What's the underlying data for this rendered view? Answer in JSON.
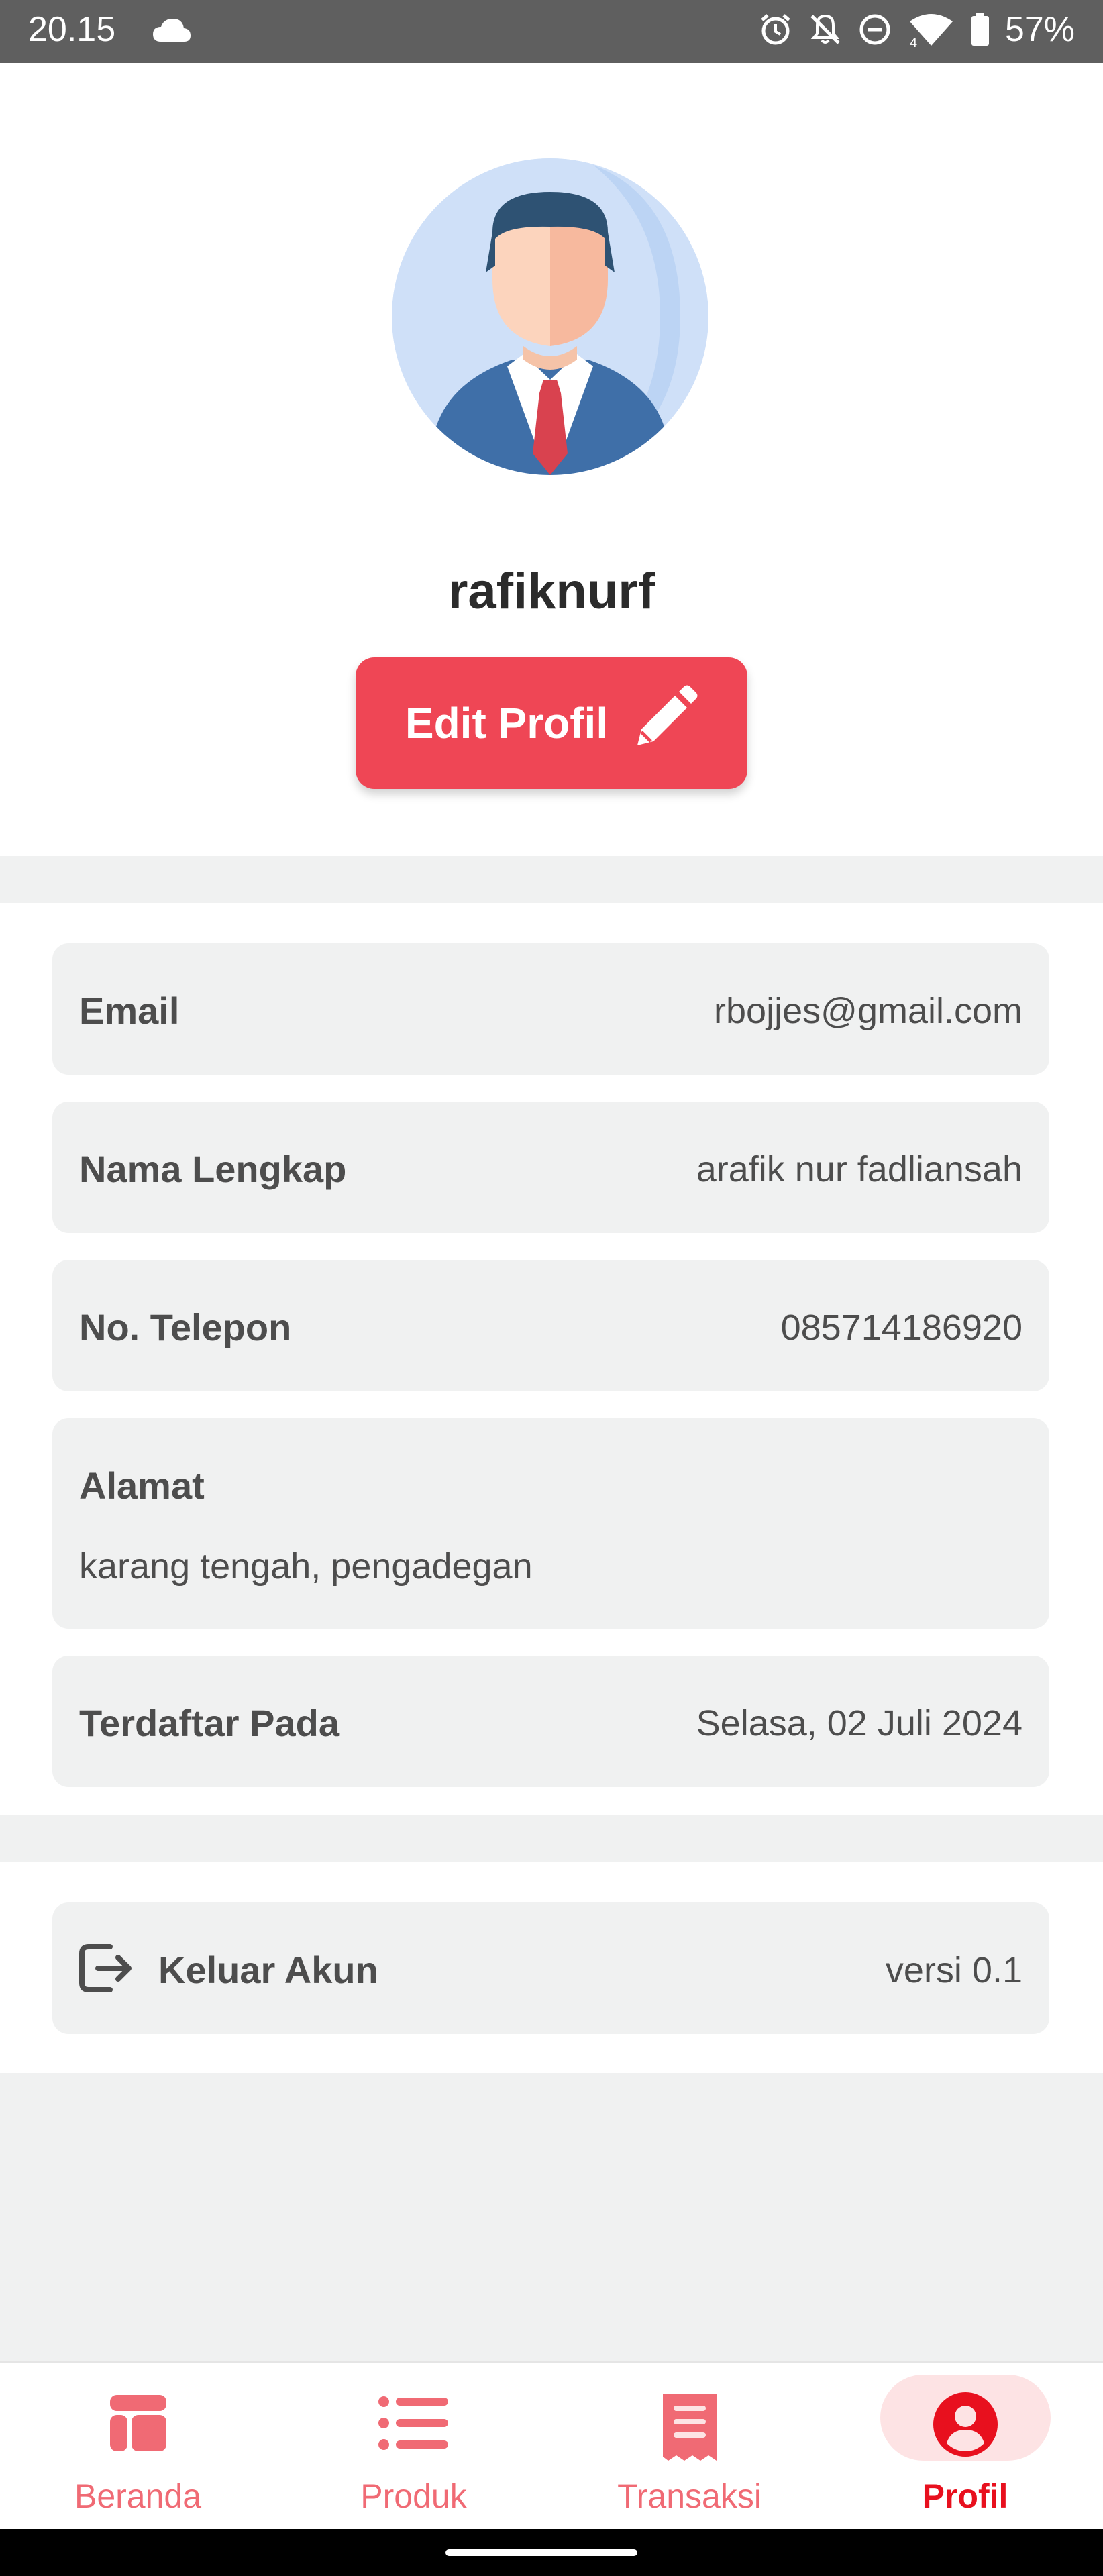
{
  "status_bar": {
    "time": "20.15",
    "battery": "57%",
    "icons": [
      "cloud-icon",
      "alarm-icon",
      "notifications-off-icon",
      "do-not-disturb-icon",
      "wifi-icon",
      "battery-icon"
    ]
  },
  "profile": {
    "username": "rafiknurf",
    "edit_button_label": "Edit Profil"
  },
  "info": {
    "email_label": "Email",
    "email_value": "rbojjes@gmail.com",
    "name_label": "Nama Lengkap",
    "name_value": "arafik nur fadliansah",
    "phone_label": "No. Telepon",
    "phone_value": "085714186920",
    "address_label": "Alamat",
    "address_value": "karang tengah, pengadegan",
    "registered_label": "Terdaftar Pada",
    "registered_value": "Selasa, 02 Juli 2024"
  },
  "account": {
    "logout_label": "Keluar Akun",
    "version": "versi 0.1"
  },
  "bottom_nav": {
    "items": [
      {
        "label": "Beranda",
        "icon": "home-dashboard-icon",
        "active": false
      },
      {
        "label": "Produk",
        "icon": "list-icon",
        "active": false
      },
      {
        "label": "Transaksi",
        "icon": "receipt-icon",
        "active": false
      },
      {
        "label": "Profil",
        "icon": "user-circle-icon",
        "active": true
      }
    ]
  },
  "colors": {
    "accent": "#ef4655",
    "nav_inactive": "#f06a74",
    "nav_active": "#e8101e",
    "card_bg": "#f0f1f1"
  }
}
